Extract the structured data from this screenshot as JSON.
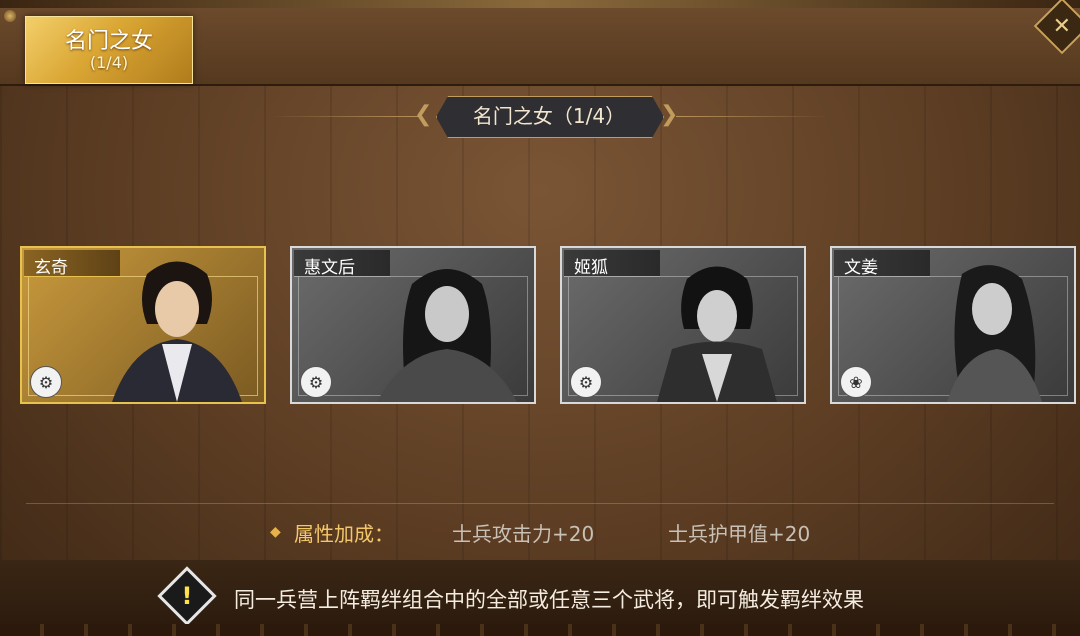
{
  "tab": {
    "label": "名门之女",
    "progress": "(1/4)"
  },
  "title": {
    "text": "名门之女（1/4）"
  },
  "cards": [
    {
      "name": "玄奇",
      "active": true,
      "unit_icon": "chariot-icon"
    },
    {
      "name": "惠文后",
      "active": false,
      "unit_icon": "chariot-icon"
    },
    {
      "name": "姬狐",
      "active": false,
      "unit_icon": "chariot-icon"
    },
    {
      "name": "文姜",
      "active": false,
      "unit_icon": "lotus-icon"
    }
  ],
  "attributes": {
    "label": "属性加成：",
    "bonus1": "士兵攻击力+20",
    "bonus2": "士兵护甲值+20"
  },
  "tip": "同一兵营上阵羁绊组合中的全部或任意三个武将，即可触发羁绊效果",
  "colors": {
    "gold": "#e8c24f",
    "accent": "#f2c66a"
  }
}
